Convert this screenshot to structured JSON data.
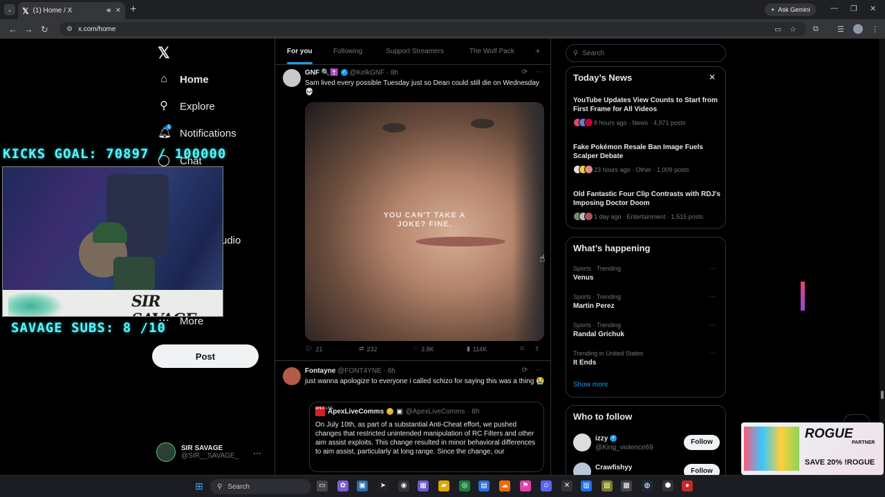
{
  "browser": {
    "tab_title": "(1) Home / X",
    "tab_logo": "𝕏",
    "new_tab": "+",
    "gemini_label": "Ask Gemini",
    "url": "x.com/home"
  },
  "sidebar": {
    "logo": "𝕏",
    "items": [
      {
        "label": "Home",
        "icon": "home-icon"
      },
      {
        "label": "Explore",
        "icon": "search-icon"
      },
      {
        "label": "Notifications",
        "icon": "bell-icon",
        "badge": "1"
      },
      {
        "label": "Chat",
        "icon": "chat-icon"
      },
      {
        "label": "udio",
        "icon": "none"
      },
      {
        "label": "More",
        "icon": "more-icon"
      }
    ],
    "post_button": "Post",
    "account": {
      "name": "SIR SAVAGE",
      "handle": "@SIR__SAVAGE_",
      "more": "···"
    }
  },
  "stream_overlay": {
    "kicks_goal": "KICKS GOAL: 70897 / 100000",
    "subs": "SAVAGE SUBS: 8 /10",
    "brand": "SIR SAVAGE"
  },
  "feed": {
    "tabs": [
      {
        "label": "For you",
        "active": true
      },
      {
        "label": "Following"
      },
      {
        "label": "Support Streamers"
      },
      {
        "label": "The Wolf Pack"
      }
    ],
    "add_tab": "+",
    "tweets": [
      {
        "name": "GNF",
        "emoji": "🔍✝️",
        "handle": "@KelkGNF",
        "time": "· 8h",
        "text": "Sam lived every possible Tuesday just so Dean could still die on Wednesday 💀",
        "media_caption": "YOU CAN'T TAKE A JOKE? FINE.",
        "replies": "21",
        "reposts": "232",
        "likes": "3.8K",
        "views": "114K"
      },
      {
        "name": "Fontayne",
        "handle": "@FONT4YNE",
        "time": "· 6h",
        "text": "just wanna apologize to everyone i called schizo for saying this was a thing 😭",
        "quote": {
          "avatar_text": "APEX LIVE",
          "name": "ApexLiveComms",
          "handle": "@ApexLiveComms",
          "time": "· 8h",
          "text": "On July 10th, as part of a substantial Anti-Cheat effort, we pushed changes that restricted unintended manipulation of RC Filters and other aim assist exploits. This change resulted in minor behavioral differences to aim assist, particularly at long range. Since the change, our"
        }
      }
    ]
  },
  "right": {
    "search_placeholder": "Search",
    "todays_news": {
      "title": "Today’s News",
      "close": "✕",
      "items": [
        {
          "title": "YouTube Updates View Counts to Start from First Frame for All Videos",
          "meta": "8 hours ago · News · 4,971 posts"
        },
        {
          "title": "Fake Pokémon Resale Ban Image Fuels Scalper Debate",
          "meta": "23 hours ago · Other · 1,009 posts"
        },
        {
          "title": "Old Fantastic Four Clip Contrasts with RDJ's Imposing Doctor Doom",
          "meta": "1 day ago · Entertainment · 1,515 posts"
        }
      ]
    },
    "whats_happening": {
      "title": "What’s happening",
      "trends": [
        {
          "context": "Sports · Trending",
          "name": "Venus"
        },
        {
          "context": "Sports · Trending",
          "name": "Martin Perez"
        },
        {
          "context": "Sports · Trending",
          "name": "Randal Grichuk"
        },
        {
          "context": "Trending in United States",
          "name": "It Ends"
        }
      ],
      "show_more": "Show more"
    },
    "who_to_follow": {
      "title": "Who to follow",
      "users": [
        {
          "name": "izzy",
          "handle": "@King_violence69",
          "button": "Follow"
        },
        {
          "name": "Crawfishyy",
          "handle": "",
          "button": "Follow"
        }
      ]
    }
  },
  "promo": {
    "brand": "ROGUE",
    "tag": "PARTNER",
    "offer": "SAVE 20% !ROGUE"
  },
  "taskbar": {
    "search_placeholder": "Search"
  }
}
